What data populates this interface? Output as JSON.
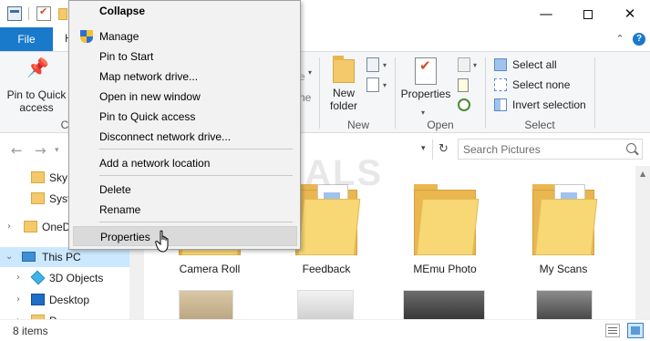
{
  "window": {
    "minimize_glyph": "—",
    "close_glyph": "✕"
  },
  "ribbon": {
    "file_tab": "File",
    "partial_tab": "H",
    "collapse_glyph": "⌃",
    "help_glyph": "?",
    "pin_to_quick_access": "Pin to Quick access",
    "clipboard_group_partial": "C",
    "partial_label_1": "e",
    "partial_label_2": "ne",
    "new_folder": "New folder",
    "new_group": "New",
    "properties": "Properties",
    "open_group": "Open",
    "select_all": "Select all",
    "select_none": "Select none",
    "invert_selection": "Invert selection",
    "select_group": "Select"
  },
  "address": {
    "search_placeholder": "Search Pictures"
  },
  "nav_pane": {
    "items": [
      {
        "label": "Sky",
        "icon": "folder-icon"
      },
      {
        "label": "Syst",
        "icon": "folder-icon"
      },
      {
        "label": "OneD",
        "icon": "folder-icon"
      },
      {
        "label": "This PC",
        "icon": "pc-icon"
      },
      {
        "label": "3D Objects",
        "icon": "3d-objects-icon"
      },
      {
        "label": "Desktop",
        "icon": "desktop-icon"
      },
      {
        "label": "D",
        "icon": "downloads-icon"
      }
    ]
  },
  "content": {
    "folders": [
      {
        "name": "Camera Roll"
      },
      {
        "name": "Feedback"
      },
      {
        "name": "MEmu Photo"
      },
      {
        "name": "My Scans"
      }
    ],
    "watermark": "A PUALS"
  },
  "status": {
    "item_count": "8 items"
  },
  "context_menu": {
    "items": [
      {
        "label": "Collapse",
        "bold": true
      },
      {
        "label": "Manage",
        "icon": "uac-shield-icon"
      },
      {
        "label": "Pin to Start"
      },
      {
        "label": "Map network drive..."
      },
      {
        "label": "Open in new window"
      },
      {
        "label": "Pin to Quick access"
      },
      {
        "label": "Disconnect network drive..."
      },
      {
        "label": "Add a network location"
      },
      {
        "label": "Delete"
      },
      {
        "label": "Rename"
      },
      {
        "label": "Properties",
        "highlighted": true
      }
    ]
  },
  "colors": {
    "accent": "#1979ca",
    "selection": "#cce8ff",
    "folder": "#f3c96b",
    "menu_bg": "#f2f2f2",
    "menu_highlight": "#dadada"
  }
}
